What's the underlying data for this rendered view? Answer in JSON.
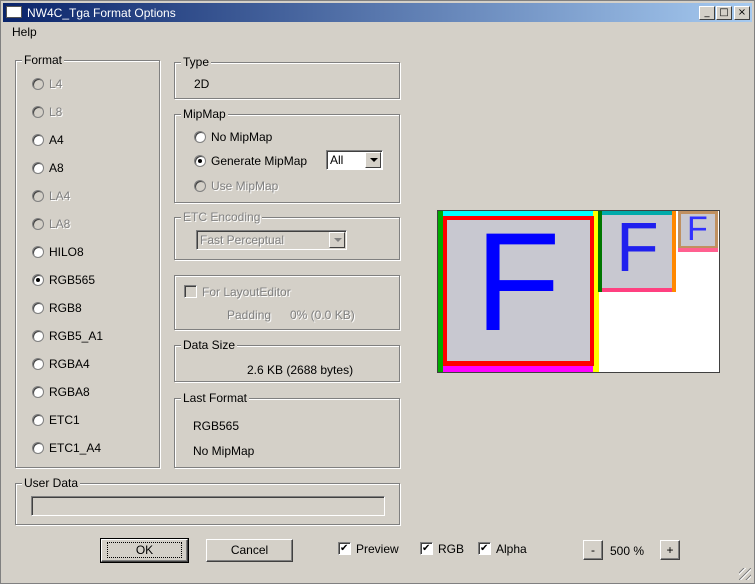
{
  "window": {
    "title": "NW4C_Tga Format Options",
    "controls": {
      "minimize": "_",
      "maximize": "□",
      "close": "×"
    }
  },
  "menu": {
    "items": [
      {
        "label": "Help"
      }
    ]
  },
  "format": {
    "label": "Format",
    "options": [
      {
        "label": "L4",
        "enabled": false,
        "checked": false
      },
      {
        "label": "L8",
        "enabled": false,
        "checked": false
      },
      {
        "label": "A4",
        "enabled": true,
        "checked": false
      },
      {
        "label": "A8",
        "enabled": true,
        "checked": false
      },
      {
        "label": "LA4",
        "enabled": false,
        "checked": false
      },
      {
        "label": "LA8",
        "enabled": false,
        "checked": false
      },
      {
        "label": "HILO8",
        "enabled": true,
        "checked": false
      },
      {
        "label": "RGB565",
        "enabled": true,
        "checked": true
      },
      {
        "label": "RGB8",
        "enabled": true,
        "checked": false
      },
      {
        "label": "RGB5_A1",
        "enabled": true,
        "checked": false
      },
      {
        "label": "RGBA4",
        "enabled": true,
        "checked": false
      },
      {
        "label": "RGBA8",
        "enabled": true,
        "checked": false
      },
      {
        "label": "ETC1",
        "enabled": true,
        "checked": false
      },
      {
        "label": "ETC1_A4",
        "enabled": true,
        "checked": false
      }
    ]
  },
  "type": {
    "label": "Type",
    "value": "2D"
  },
  "mipmap": {
    "label": "MipMap",
    "no_mipmap": "No MipMap",
    "generate_mipmap": "Generate MipMap",
    "use_mipmap": "Use MipMap",
    "level_select": "All"
  },
  "etc": {
    "label": "ETC Encoding",
    "value": "Fast Perceptual"
  },
  "layout_editor": {
    "checkbox_label": "For LayoutEditor",
    "padding_label": "Padding",
    "padding_value": "0% (0.0 KB)"
  },
  "data_size": {
    "label": "Data Size",
    "value": "2.6 KB (2688 bytes)"
  },
  "last_format": {
    "label": "Last Format",
    "format": "RGB565",
    "mipmap": "No MipMap"
  },
  "user_data": {
    "label": "User Data",
    "value": ""
  },
  "buttons": {
    "ok": "OK",
    "cancel": "Cancel"
  },
  "view_options": {
    "preview": "Preview",
    "rgb": "RGB",
    "alpha": "Alpha"
  },
  "zoom": {
    "minus": "-",
    "value": "500 %",
    "plus": "+"
  },
  "preview_glyph": "F",
  "colors": {
    "title_start": "#0a246a",
    "title_end": "#a6caf0",
    "glyph": "#0000ff"
  }
}
